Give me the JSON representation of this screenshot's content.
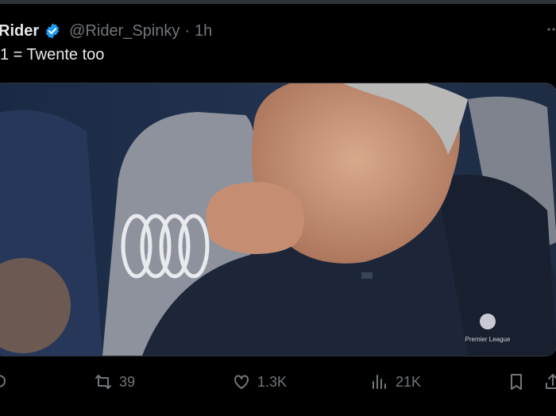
{
  "tweet": {
    "display_name": "Rider",
    "handle": "@Rider_Spinky",
    "separator": "·",
    "time": "1h",
    "text": "1 = Twente too"
  },
  "media": {
    "description_icons": [
      "audi-rings-logo",
      "premier-league-logo"
    ],
    "logo_text": "Premier League"
  },
  "actions": {
    "retweets": "39",
    "likes": "1.3K",
    "views": "21K"
  },
  "colors": {
    "background": "#000000",
    "text": "#e7e9ea",
    "muted": "#71767b",
    "verified": "#1d9bf0"
  },
  "icons": [
    "verified-badge-icon",
    "more-icon",
    "reply-icon",
    "retweet-icon",
    "like-icon",
    "views-icon",
    "bookmark-icon",
    "share-icon"
  ]
}
